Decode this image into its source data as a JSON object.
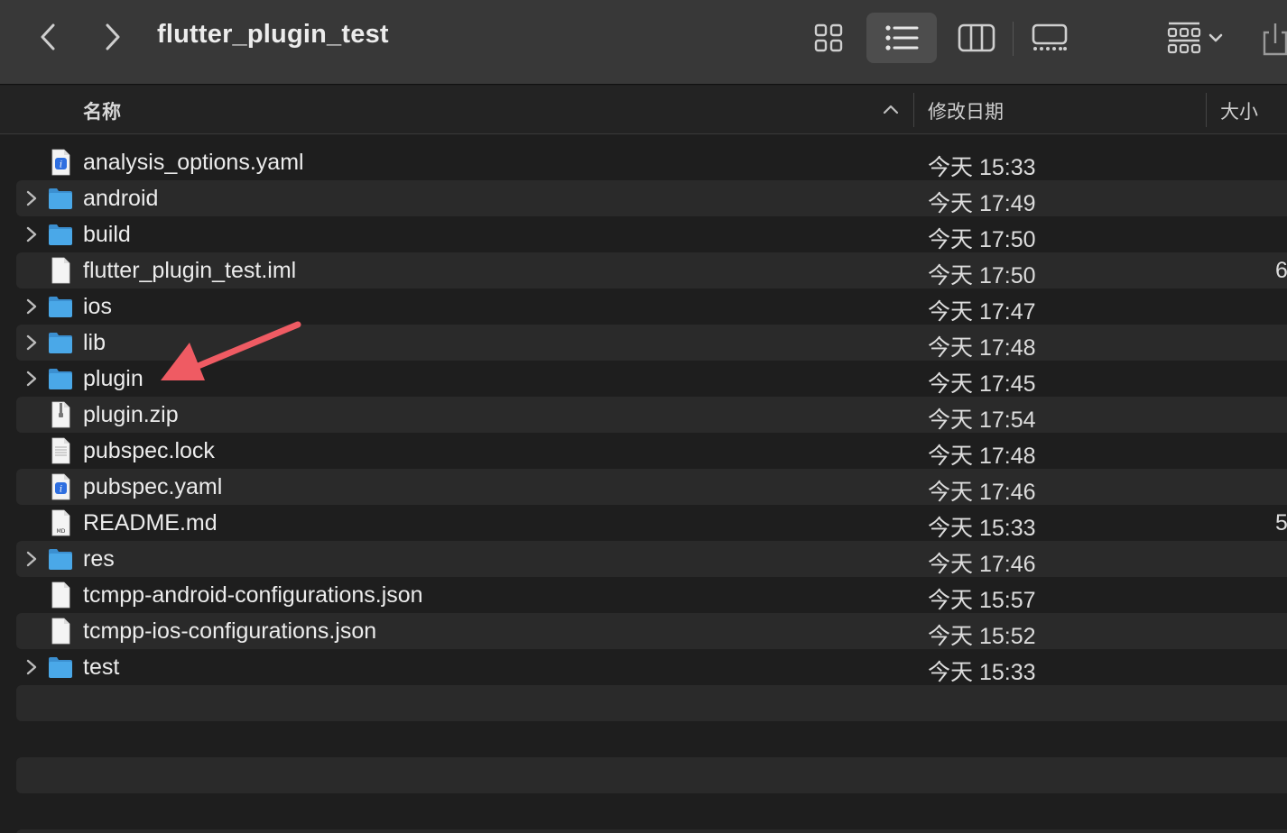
{
  "window": {
    "title": "flutter_plugin_test"
  },
  "toolbar": {
    "view_modes": [
      "grid-view-icon",
      "list-view-icon",
      "column-view-icon",
      "gallery-view-icon"
    ],
    "active_view": "list"
  },
  "header": {
    "name": "名称",
    "date_modified": "修改日期",
    "size": "大小"
  },
  "files": [
    {
      "name": "analysis_options.yaml",
      "date": "今天 15:33",
      "size": "",
      "type": "yaml",
      "folder": false
    },
    {
      "name": "android",
      "date": "今天 17:49",
      "size": "",
      "type": "folder",
      "folder": true
    },
    {
      "name": "build",
      "date": "今天 17:50",
      "size": "",
      "type": "folder",
      "folder": true
    },
    {
      "name": "flutter_plugin_test.iml",
      "date": "今天 17:50",
      "size": "6",
      "type": "doc",
      "folder": false
    },
    {
      "name": "ios",
      "date": "今天 17:47",
      "size": "",
      "type": "folder",
      "folder": true
    },
    {
      "name": "lib",
      "date": "今天 17:48",
      "size": "",
      "type": "folder",
      "folder": true
    },
    {
      "name": "plugin",
      "date": "今天 17:45",
      "size": "",
      "type": "folder",
      "folder": true
    },
    {
      "name": "plugin.zip",
      "date": "今天 17:54",
      "size": "",
      "type": "zip",
      "folder": false
    },
    {
      "name": "pubspec.lock",
      "date": "今天 17:48",
      "size": "",
      "type": "text",
      "folder": false
    },
    {
      "name": "pubspec.yaml",
      "date": "今天 17:46",
      "size": "",
      "type": "yaml",
      "folder": false
    },
    {
      "name": "README.md",
      "date": "今天 15:33",
      "size": "5",
      "type": "md",
      "folder": false
    },
    {
      "name": "res",
      "date": "今天 17:46",
      "size": "",
      "type": "folder",
      "folder": true
    },
    {
      "name": "tcmpp-android-configurations.json",
      "date": "今天 15:57",
      "size": "",
      "type": "doc",
      "folder": false
    },
    {
      "name": "tcmpp-ios-configurations.json",
      "date": "今天 15:52",
      "size": "",
      "type": "doc",
      "folder": false
    },
    {
      "name": "test",
      "date": "今天 15:33",
      "size": "",
      "type": "folder",
      "folder": true
    }
  ],
  "colors": {
    "toolbar_bg": "#383838",
    "list_bg": "#1e1e1e",
    "row_alt_bg": "#2a2a2a",
    "folder_blue": "#4aa8e8",
    "annotation_arrow": "#ef5b63"
  }
}
